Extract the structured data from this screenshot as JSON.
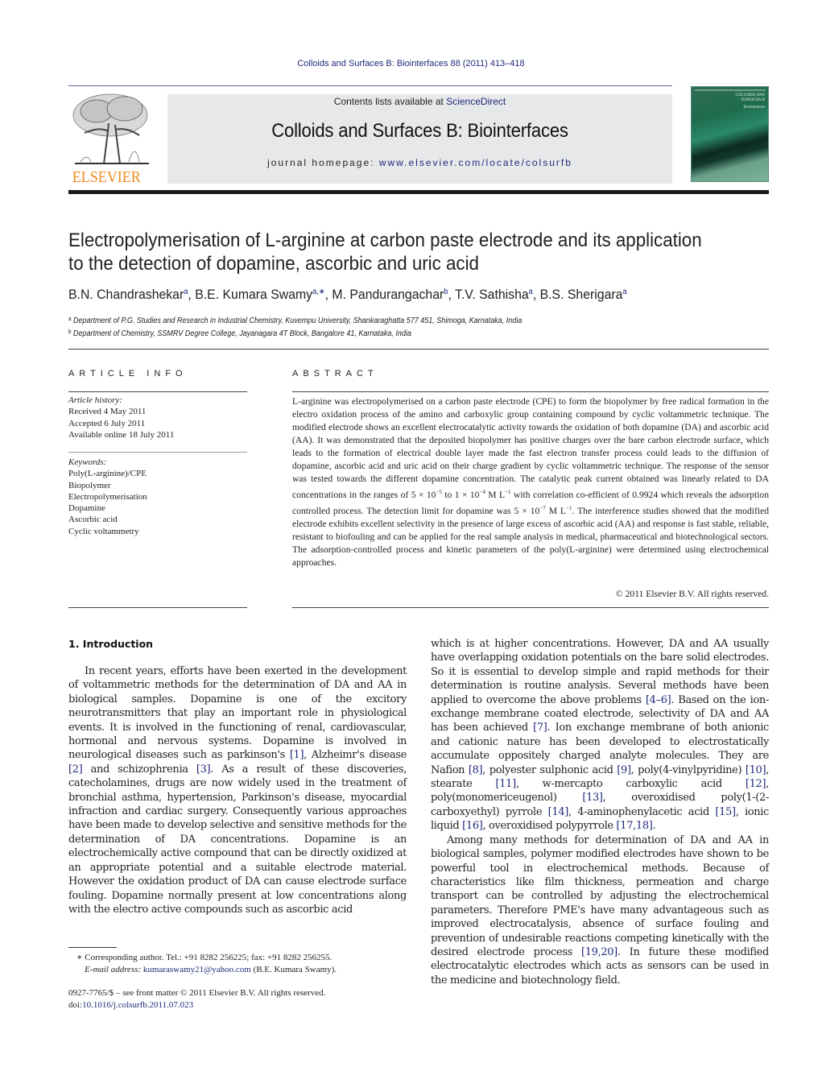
{
  "header": {
    "journal_ref": "Colloids and Surfaces B: Biointerfaces 88 (2011) 413–418",
    "contents_prefix": "Contents lists available at ",
    "contents_link": "ScienceDirect",
    "journal_title": "Colloids and Surfaces B: Biointerfaces",
    "homepage_prefix": "journal homepage: ",
    "homepage_link": "www.elsevier.com/locate/colsurfb",
    "publisher_name": "ELSEVIER",
    "cover_title_line1": "COLLOIDS AND",
    "cover_title_line2": "SURFACES B",
    "cover_subtitle": "Biointerfaces",
    "colors": {
      "link": "#1f2a7a",
      "publisher_orange": "#f08a1e",
      "masthead_bg": "#e7e8ea"
    }
  },
  "article": {
    "title_line1": "Electropolymerisation of L-arginine at carbon paste electrode and its application",
    "title_line2": "to the detection of dopamine, ascorbic and uric acid",
    "authors": [
      {
        "name": "B.N. Chandrashekar",
        "affil": "a"
      },
      {
        "name": "B.E. Kumara Swamy",
        "affil": "a,∗"
      },
      {
        "name": "M. Pandurangachar",
        "affil": "b"
      },
      {
        "name": "T.V. Sathisha",
        "affil": "a"
      },
      {
        "name": "B.S. Sherigara",
        "affil": "a"
      }
    ],
    "affiliations": [
      {
        "key": "a",
        "text": "Department of P.G. Studies and Research in Industrial Chemistry, Kuvempu University, Shankaraghatta 577 451, Shimoga, Karnataka, India"
      },
      {
        "key": "b",
        "text": "Department of Chemistry, SSMRV Degree College, Jayanagara 4T Block, Bangalore 41, Karnataka, India"
      }
    ]
  },
  "article_info": {
    "heading": "ARTICLE INFO",
    "history_label": "Article history:",
    "history": [
      "Received 4 May 2011",
      "Accepted 6 July 2011",
      "Available online 18 July 2011"
    ],
    "keywords_label": "Keywords:",
    "keywords": [
      "Poly(L-arginine)/CPE",
      "Biopolymer",
      "Electropolymerisation",
      "Dopamine",
      "Ascorbic acid",
      "Cyclic voltammetry"
    ]
  },
  "abstract": {
    "heading": "ABSTRACT",
    "part1": "L-arginine was electropolymerised on a carbon paste electrode (CPE) to form the biopolymer by free radical formation in the electro oxidation process of the amino and carboxylic group containing compound by cyclic voltammetric technique. The modified electrode shows an excellent electrocatalytic activity towards the oxidation of both dopamine (DA) and ascorbic acid (AA). It was demonstrated that the deposited biopolymer has positive charges over the bare carbon electrode surface, which leads to the formation of electrical double layer made the fast electron transfer process could leads to the diffusion of dopamine, ascorbic acid and uric acid on their charge gradient by cyclic voltammetric technique. The response of the sensor was tested towards the different dopamine concentration. The catalytic peak current obtained was linearly related to DA concentrations in the ranges of 5 × 10",
    "exp1": "−5",
    "part2": " to 1 × 10",
    "exp2": "−4",
    "part3": " M L",
    "exp3": "−1",
    "part4": " with correlation co-efficient of 0.9924 which reveals the adsorption controlled process. The detection limit for dopamine was 5 × 10",
    "exp4": "−7",
    "part5": " M L",
    "exp5": "−1",
    "part6": ". The interference studies showed that the modified electrode exhibits excellent selectivity in the presence of large excess of ascorbic acid (AA) and response is fast stable, reliable, resistant to biofouling and can be applied for the real sample analysis in medical, pharmaceutical and biotechnological sectors. The adsorption-controlled process and kinetic parameters of the poly(L-arginine) were determined using electrochemical approaches.",
    "copyright": "© 2011 Elsevier B.V. All rights reserved."
  },
  "introduction": {
    "heading": "1.  Introduction",
    "left_column": {
      "t1": "In recent years, efforts have been exerted in the development of voltammetric methods for the determination of DA and AA in biological samples. Dopamine is one of the excitory neurotransmitters that play an important role in physiological events. It is involved in the functioning of renal, cardiovascular, hormonal and nervous systems. Dopamine is involved in neurological diseases such as parkinson's ",
      "r1": "[1]",
      "t2": ", Alzheimr's disease ",
      "r2": "[2]",
      "t3": " and schizophrenia ",
      "r3": "[3]",
      "t4": ". As a result of these discoveries, catecholamines, drugs are now widely used in the treatment of bronchial asthma, hypertension, Parkinson's disease, myocardial infraction and cardiac surgery. Consequently various approaches have been made to develop selective and sensitive methods for the determination of DA concentrations. Dopamine is an electrochemically active compound that can be directly oxidized at an appropriate potential and a suitable electrode material. However the oxidation product of DA can cause electrode surface fouling. Dopamine normally present at low concentrations along with the electro active compounds such as ascorbic acid"
    },
    "right_column": {
      "p1_t1": "which is at higher concentrations. However, DA and AA usually have overlapping oxidation potentials on the bare solid electrodes. So it is essential to develop simple and rapid methods for their determination is routine analysis. Several methods have been applied to overcome the above problems ",
      "p1_r1": "[4–6]",
      "p1_t2": ". Based on the ion-exchange membrane coated electrode, selectivity of DA and AA has been achieved ",
      "p1_r2": "[7]",
      "p1_t3": ". Ion exchange membrane of both anionic and cationic nature has been developed to electrostatically accumulate oppositely charged analyte molecules. They are Nafion ",
      "p1_r3": "[8]",
      "p1_t4": ", polyester sulphonic acid ",
      "p1_r4": "[9]",
      "p1_t5": ", poly(4-vinylpyridine) ",
      "p1_r5": "[10]",
      "p1_t6": ", stearate ",
      "p1_r6": "[11]",
      "p1_t7": ", w-mercapto carboxylic acid ",
      "p1_r7": "[12]",
      "p1_t8": ", poly(monomericeugenol) ",
      "p1_r8": "[13]",
      "p1_t9": ", overoxidised poly(1-(2-carboxyethyl) pyrrole ",
      "p1_r9": "[14]",
      "p1_t10": ", 4-aminophenylacetic acid ",
      "p1_r10": "[15]",
      "p1_t11": ", ionic liquid ",
      "p1_r11": "[16]",
      "p1_t12": ", overoxidised polypyrrole ",
      "p1_r12": "[17,18]",
      "p1_t13": ".",
      "p2_t1": "Among many methods for determination of DA and AA in biological samples, polymer modified electrodes have shown to be powerful tool in electrochemical methods. Because of characteristics like film thickness, permeation and charge transport can be controlled by adjusting the electrochemical parameters. Therefore PME's have many advantageous such as improved electrocatalysis, absence of surface fouling and prevention of undesirable reactions competing kinetically with the desired electrode process ",
      "p2_r1": "[19,20]",
      "p2_t2": ". In future these modified electrocatalytic electrodes which acts as sensors can be used in the medicine and biotechnology field."
    }
  },
  "footnotes": {
    "marker": "∗",
    "corresponding": " Corresponding author. Tel.: +91 8282 256225; fax: +91 8282 256255.",
    "email_label": "E-mail address:",
    "email": "kumaraswamy21@yahoo.com",
    "email_owner": " (B.E. Kumara Swamy).",
    "front_matter": "0927-7765/$ – see front matter © 2011 Elsevier B.V. All rights reserved.",
    "doi_prefix": "doi:",
    "doi_link": "10.1016/j.colsurfb.2011.07.023"
  }
}
